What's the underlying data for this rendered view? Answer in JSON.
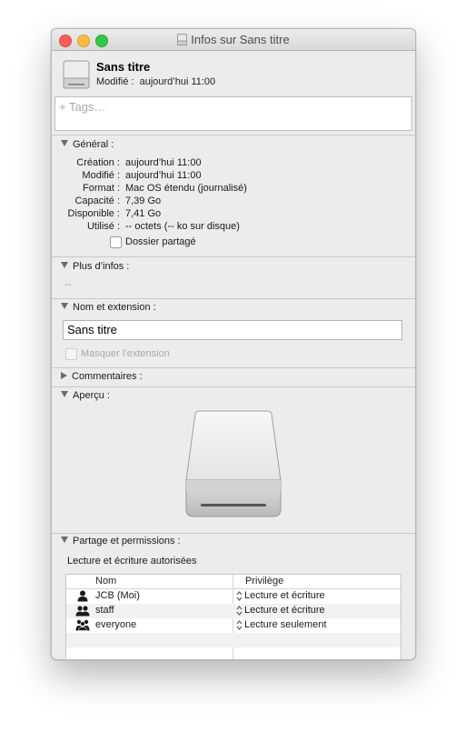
{
  "window": {
    "title": "Infos sur Sans titre"
  },
  "header": {
    "name": "Sans titre",
    "modified_label": "Modifié :",
    "modified_value": "aujourd’hui 11:00"
  },
  "tags": {
    "placeholder": "+ Tags…"
  },
  "general": {
    "title": "Général :",
    "rows": [
      {
        "label": "Création :",
        "value": "aujourd’hui 11:00"
      },
      {
        "label": "Modifié :",
        "value": "aujourd’hui 11:00"
      },
      {
        "label": "Format :",
        "value": "Mac OS étendu (journalisé)"
      },
      {
        "label": "Capacité :",
        "value": "7,39 Go"
      },
      {
        "label": "Disponible :",
        "value": "7,41 Go"
      },
      {
        "label": "Utilisé :",
        "value": "-- octets (-- ko sur disque)"
      }
    ],
    "shared_folder_label": "Dossier partagé",
    "shared_folder_checked": false
  },
  "more_info": {
    "title": "Plus d’infos :",
    "value": "--"
  },
  "name_ext": {
    "title": "Nom et extension :",
    "name_value": "Sans titre",
    "hide_ext_label": "Masquer l’extension",
    "hide_ext_checked": false
  },
  "comments": {
    "title": "Commentaires :"
  },
  "preview": {
    "title": "Aperçu :",
    "icon": "external-drive-icon"
  },
  "sharing": {
    "title": "Partage et permissions :",
    "status": "Lecture et écriture autorisées",
    "columns": [
      "Nom",
      "Privilège"
    ],
    "rows": [
      {
        "name": "JCB (Moi)",
        "privilege": "Lecture et écriture",
        "icon": "user-icon"
      },
      {
        "name": "staff",
        "privilege": "Lecture et écriture",
        "icon": "group-icon"
      },
      {
        "name": "everyone",
        "privilege": "Lecture seulement",
        "icon": "everyone-icon"
      }
    ]
  },
  "colors": {
    "window_bg": "#ececec",
    "close": "#fc605c",
    "minimize": "#fdbc40",
    "zoom": "#34c84a"
  }
}
